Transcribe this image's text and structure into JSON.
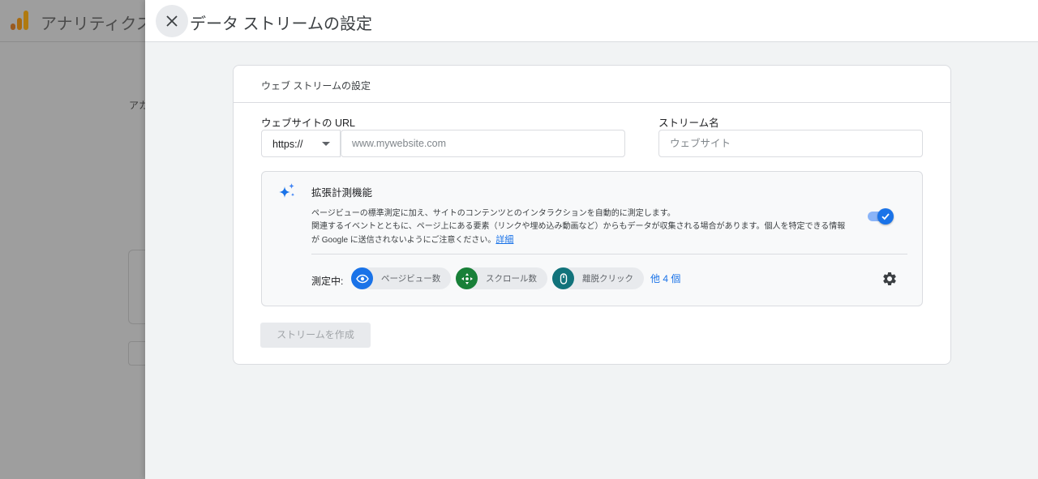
{
  "background": {
    "app_title": "アナリティクス",
    "side_text": "アカ"
  },
  "panel": {
    "title": "データ ストリームの設定",
    "close_icon": "close-icon"
  },
  "card": {
    "header": "ウェブ ストリームの設定",
    "url_label": "ウェブサイトの URL",
    "protocol_value": "https://",
    "url_placeholder": "www.mywebsite.com",
    "stream_name_label": "ストリーム名",
    "stream_name_placeholder": "ウェブサイト"
  },
  "enhanced": {
    "title": "拡張計測機能",
    "desc_line1": "ページビューの標準測定に加え、サイトのコンテンツとのインタラクションを自動的に測定します。",
    "desc_line2": "関連するイベントとともに、ページ上にある要素（リンクや埋め込み動画など）からもデータが収集される場合があります。個人を特定できる情報",
    "desc_line3": "が Google に送信されないようにご注意ください。",
    "details_link": "詳細",
    "toggle_on": true,
    "measuring_label": "測定中:",
    "chips": [
      {
        "label": "ページビュー数",
        "icon": "eye-icon",
        "color": "#1a73e8"
      },
      {
        "label": "スクロール数",
        "icon": "move-arrows-icon",
        "color": "#188038"
      },
      {
        "label": "離脱クリック",
        "icon": "mouse-icon",
        "color": "#12737b"
      }
    ],
    "more_link": "他 4 個",
    "settings_icon": "gear-icon"
  },
  "create_button": "ストリームを作成",
  "colors": {
    "accent": "#1a73e8",
    "logo_orange": "#e37400",
    "logo_yellow": "#f9ab00"
  }
}
